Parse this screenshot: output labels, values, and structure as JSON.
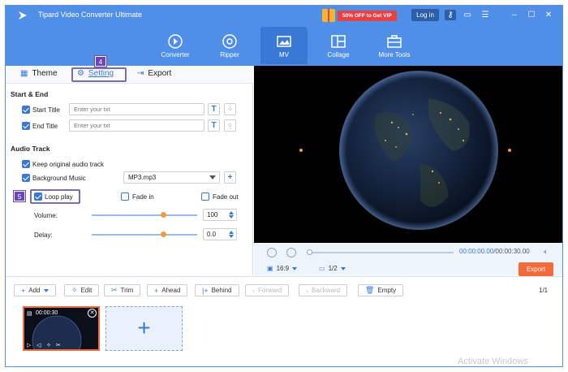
{
  "app": {
    "title": "Tipard Video Converter Ultimate"
  },
  "titlebar": {
    "promo": "50% OFF to Get VIP",
    "login": "Log in"
  },
  "toolbar": {
    "items": [
      {
        "label": "Converter"
      },
      {
        "label": "Ripper"
      },
      {
        "label": "MV"
      },
      {
        "label": "Collage"
      },
      {
        "label": "More Tools"
      }
    ]
  },
  "tabs": {
    "theme": "Theme",
    "setting": "Setting",
    "export": "Export"
  },
  "callouts": {
    "four": "4",
    "five": "5"
  },
  "start_end": {
    "heading": "Start & End",
    "start_label": "Start Title",
    "start_placeholder": "Enter your txt",
    "end_label": "End Title",
    "end_placeholder": "Enter your txt",
    "t_glyph": "T"
  },
  "audio": {
    "heading": "Audio Track",
    "keep_original": "Keep original audio track",
    "background_music": "Background Music",
    "music_file": "MP3.mp3",
    "loop_play": "Loop play",
    "fade_in": "Fade in",
    "fade_out": "Fade out",
    "volume_label": "Volume:",
    "volume_value": "100",
    "volume_level": 0.68,
    "delay_label": "Delay:",
    "delay_value": "0.0",
    "delay_level": 0.68
  },
  "playback": {
    "time_current": "00:00:00.00",
    "time_total": "/00:00:30.00",
    "ratio": "16:9",
    "screen": "1/2",
    "export": "Export"
  },
  "bottom": {
    "add": "Add",
    "edit": "Edit",
    "trim": "Trim",
    "ahead": "Ahead",
    "behind": "Behind",
    "forward": "Forward",
    "backward": "Backward",
    "empty": "Empty",
    "pager": "1/1"
  },
  "clip": {
    "duration": "00:00:30"
  },
  "watermark": "Activate Windows",
  "colors": {
    "accent": "#4f8fe7",
    "export": "#f46a3a",
    "callout": "#6b47b4",
    "slider_knob": "#f39a3d"
  }
}
